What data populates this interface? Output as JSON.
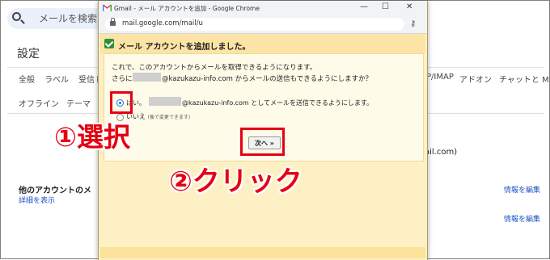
{
  "background": {
    "search_placeholder": "メールを検索",
    "page_title": "設定",
    "tabs_row1": [
      "全般",
      "ラベル",
      "受信ト"
    ],
    "tabs_right": [
      "P/IMAP",
      "アドオン",
      "チャットと M"
    ],
    "tabs_row2": [
      "オフライン",
      "テーマ"
    ],
    "partial_email": "ail.com)",
    "section_label": "他のアカウントのメ",
    "show_details": "詳細を表示",
    "edit_link_1": "情報を編集",
    "edit_link_2": "情報を編集"
  },
  "window": {
    "title": "Gmail - メール アカウントを追加 - Google Chrome",
    "url": "mail.google.com/mail/u"
  },
  "dialog": {
    "header": "メール アカウントを追加しました。",
    "line1": "これで、このアカウントからメールを取得できるようになります。",
    "line2_prefix": "さらに",
    "line2_suffix": "@kazukazu-info.com からメールの送信もできるようにしますか？",
    "option_yes_prefix": "はい。",
    "option_yes_suffix": "@kazukazu-info.com としてメールを送信できるようにします。",
    "option_no": "いいえ",
    "option_no_note": "(後で変更できます)",
    "next_button": "次へ »",
    "selected_option": "yes"
  },
  "annotations": {
    "step1": "①選択",
    "step2": "②クリック",
    "color": "#e60012"
  }
}
